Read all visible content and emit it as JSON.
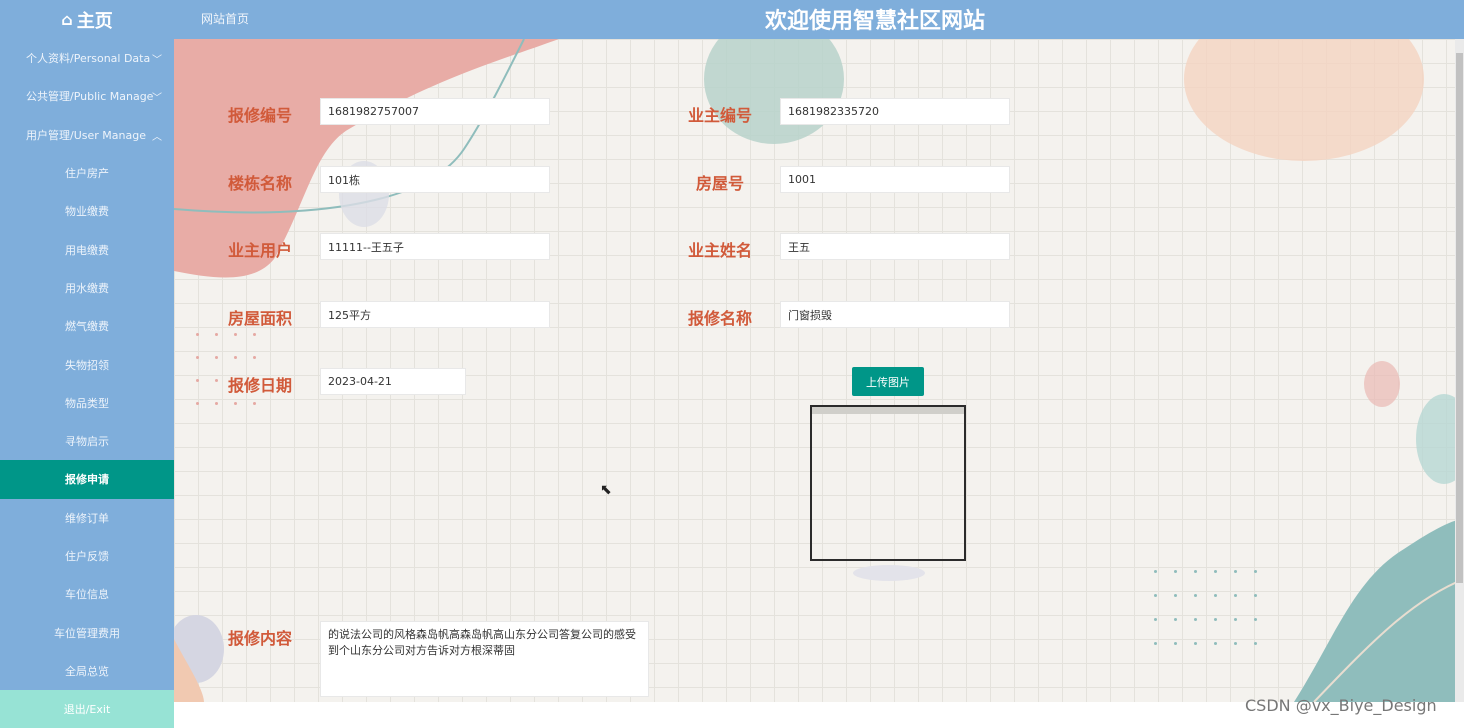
{
  "header": {
    "brand": "主页",
    "breadcrumb": "网站首页",
    "site_title": "欢迎使用智慧社区网站"
  },
  "sidebar": {
    "groups": [
      {
        "label": "个人资料/Personal Data"
      },
      {
        "label": "公共管理/Public Manage"
      },
      {
        "label": "用户管理/User Manage"
      }
    ],
    "items": [
      {
        "label": "住户房产"
      },
      {
        "label": "物业缴费"
      },
      {
        "label": "用电缴费"
      },
      {
        "label": "用水缴费"
      },
      {
        "label": "燃气缴费"
      },
      {
        "label": "失物招领"
      },
      {
        "label": "物品类型"
      },
      {
        "label": "寻物启示"
      },
      {
        "label": "报修申请"
      },
      {
        "label": "维修订单"
      },
      {
        "label": "住户反馈"
      },
      {
        "label": "车位信息"
      },
      {
        "label": "车位管理费用"
      },
      {
        "label": "全局总览"
      }
    ],
    "exit": "退出/Exit",
    "active_index": 8
  },
  "form": {
    "repair_no": {
      "label": "报修编号",
      "value": "1681982757007"
    },
    "owner_no": {
      "label": "业主编号",
      "value": "1681982335720"
    },
    "building": {
      "label": "楼栋名称",
      "value": "101栋"
    },
    "room_no": {
      "label": "房屋号",
      "value": "1001"
    },
    "owner_user": {
      "label": "业主用户",
      "value": "11111--王五子"
    },
    "owner_name": {
      "label": "业主姓名",
      "value": "王五"
    },
    "area": {
      "label": "房屋面积",
      "value": "125平方"
    },
    "repair_name": {
      "label": "报修名称",
      "value": "门窗损毁"
    },
    "repair_date": {
      "label": "报修日期",
      "value": "2023-04-21"
    },
    "upload_label": "上传图片",
    "content": {
      "label": "报修内容",
      "value": "的说法公司的风格森岛帆高森岛帆高山东分公司答复公司的感受到个山东分公司对方告诉对方根深蒂固"
    }
  },
  "watermark": "CSDN @vx_Biye_Design",
  "colors": {
    "header_bg": "#7faedb",
    "active_item": "#009688",
    "label_red": "#d15a3a",
    "exit_bg": "#97e3d5"
  }
}
